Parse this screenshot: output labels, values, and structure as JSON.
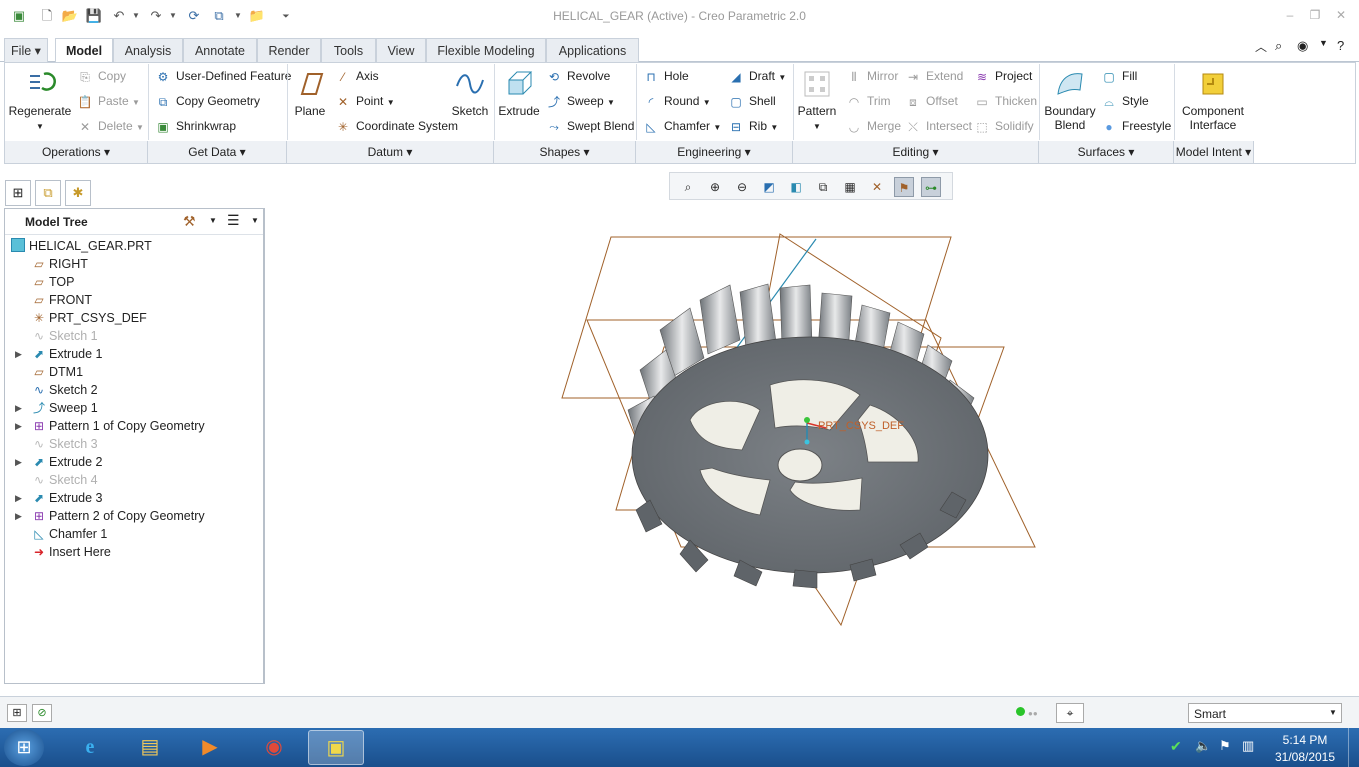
{
  "title_bar": {
    "title": "HELICAL_GEAR (Active) - Creo Parametric 2.0"
  },
  "menu_tabs": [
    "File",
    "Model",
    "Analysis",
    "Annotate",
    "Render",
    "Tools",
    "View",
    "Flexible Modeling",
    "Applications"
  ],
  "active_tab": "Model",
  "ribbon": {
    "operations": {
      "regenerate": "Regenerate",
      "copy": "Copy",
      "paste": "Paste",
      "delete": "Delete",
      "footer": "Operations"
    },
    "get_data": {
      "udf": "User-Defined Feature",
      "copy_geometry": "Copy Geometry",
      "shrinkwrap": "Shrinkwrap",
      "footer": "Get Data"
    },
    "datum": {
      "plane": "Plane",
      "axis": "Axis",
      "point": "Point",
      "csys": "Coordinate System",
      "sketch": "Sketch",
      "footer": "Datum"
    },
    "shapes": {
      "extrude": "Extrude",
      "revolve": "Revolve",
      "sweep": "Sweep",
      "swept_blend": "Swept Blend",
      "footer": "Shapes"
    },
    "engineering": {
      "hole": "Hole",
      "round": "Round",
      "chamfer": "Chamfer",
      "draft": "Draft",
      "shell": "Shell",
      "rib": "Rib",
      "footer": "Engineering"
    },
    "editing": {
      "pattern": "Pattern",
      "mirror": "Mirror",
      "trim": "Trim",
      "merge": "Merge",
      "extend": "Extend",
      "offset": "Offset",
      "intersect": "Intersect",
      "project": "Project",
      "thicken": "Thicken",
      "solidify": "Solidify",
      "footer": "Editing"
    },
    "surfaces": {
      "boundary_blend_1": "Boundary",
      "boundary_blend_2": "Blend",
      "fill": "Fill",
      "style": "Style",
      "freestyle": "Freestyle",
      "footer": "Surfaces"
    },
    "model_intent": {
      "component_1": "Component",
      "component_2": "Interface",
      "footer": "Model Intent"
    }
  },
  "model_tree": {
    "header": "Model Tree",
    "root": "HELICAL_GEAR.PRT",
    "items": [
      {
        "label": "RIGHT",
        "icon": "datum-plane-icon",
        "expandable": false,
        "dim": false
      },
      {
        "label": "TOP",
        "icon": "datum-plane-icon",
        "expandable": false,
        "dim": false
      },
      {
        "label": "FRONT",
        "icon": "datum-plane-icon",
        "expandable": false,
        "dim": false
      },
      {
        "label": "PRT_CSYS_DEF",
        "icon": "csys-icon",
        "expandable": false,
        "dim": false
      },
      {
        "label": "Sketch 1",
        "icon": "sketch-icon",
        "expandable": false,
        "dim": true
      },
      {
        "label": "Extrude 1",
        "icon": "extrude-icon",
        "expandable": true,
        "dim": false
      },
      {
        "label": "DTM1",
        "icon": "datum-plane-icon",
        "expandable": false,
        "dim": false
      },
      {
        "label": "Sketch 2",
        "icon": "sketch-icon",
        "expandable": false,
        "dim": false
      },
      {
        "label": "Sweep 1",
        "icon": "sweep-icon",
        "expandable": true,
        "dim": false
      },
      {
        "label": "Pattern 1 of Copy Geometry",
        "icon": "pattern-icon",
        "expandable": true,
        "dim": false
      },
      {
        "label": "Sketch 3",
        "icon": "sketch-icon",
        "expandable": false,
        "dim": true
      },
      {
        "label": "Extrude 2",
        "icon": "extrude-icon",
        "expandable": true,
        "dim": false
      },
      {
        "label": "Sketch 4",
        "icon": "sketch-icon",
        "expandable": false,
        "dim": true
      },
      {
        "label": "Extrude 3",
        "icon": "extrude-icon",
        "expandable": true,
        "dim": false
      },
      {
        "label": "Pattern 2 of Copy Geometry",
        "icon": "pattern-icon",
        "expandable": true,
        "dim": false
      },
      {
        "label": "Chamfer 1",
        "icon": "chamfer-icon",
        "expandable": false,
        "dim": false
      },
      {
        "label": "Insert Here",
        "icon": "insert-arrow-icon",
        "expandable": false,
        "dim": false
      }
    ]
  },
  "viewport": {
    "csys_label": "PRT_CSYS_DEF"
  },
  "status_bar": {
    "filter": "Smart"
  },
  "taskbar": {
    "time": "5:14 PM",
    "date": "31/08/2015"
  },
  "colors": {
    "accent": "#2c6db2",
    "datum": "#a0612a",
    "gear": "#6e7378"
  }
}
